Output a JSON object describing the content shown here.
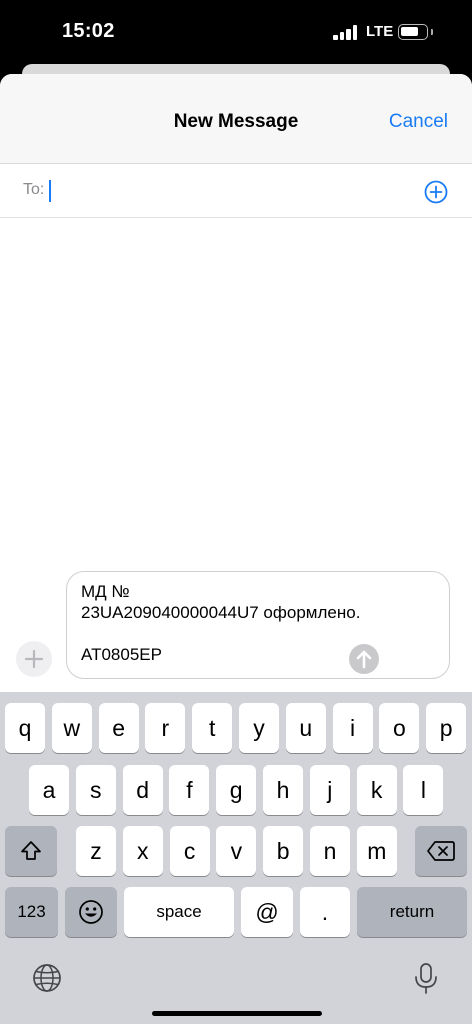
{
  "status_bar": {
    "time": "15:02",
    "network": "LTE",
    "battery_level_percent": 70
  },
  "nav": {
    "title": "New Message",
    "cancel_label": "Cancel"
  },
  "recipient": {
    "label": "To:",
    "value": ""
  },
  "message": {
    "text": "МД №\n23UA209040000044U7 оформлено.\n\nAT0805EP"
  },
  "keyboard": {
    "row1": [
      "q",
      "w",
      "e",
      "r",
      "t",
      "y",
      "u",
      "i",
      "o",
      "p"
    ],
    "row2": [
      "a",
      "s",
      "d",
      "f",
      "g",
      "h",
      "j",
      "k",
      "l"
    ],
    "row3": [
      "z",
      "x",
      "c",
      "v",
      "b",
      "n",
      "m"
    ],
    "numbers_label": "123",
    "space_label": "space",
    "at_label": "@",
    "period_label": ".",
    "return_label": "return",
    "icons": [
      "shift-icon",
      "backspace-icon",
      "emoji-icon",
      "globe-icon",
      "microphone-icon"
    ]
  },
  "colors": {
    "accent": "#1a7cf5",
    "keyboard_bg": "#d1d3d9",
    "key_dark": "#aeb3bc"
  }
}
